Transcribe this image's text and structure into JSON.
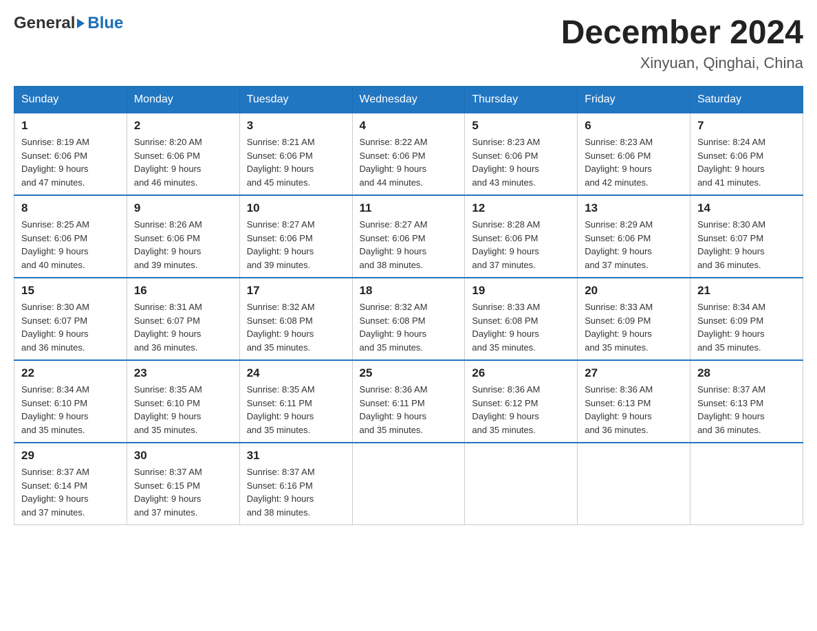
{
  "header": {
    "logo": {
      "general": "General",
      "blue": "Blue"
    },
    "title": "December 2024",
    "location": "Xinyuan, Qinghai, China"
  },
  "calendar": {
    "days_of_week": [
      "Sunday",
      "Monday",
      "Tuesday",
      "Wednesday",
      "Thursday",
      "Friday",
      "Saturday"
    ],
    "weeks": [
      [
        {
          "day": "1",
          "sunrise": "8:19 AM",
          "sunset": "6:06 PM",
          "daylight": "9 hours and 47 minutes."
        },
        {
          "day": "2",
          "sunrise": "8:20 AM",
          "sunset": "6:06 PM",
          "daylight": "9 hours and 46 minutes."
        },
        {
          "day": "3",
          "sunrise": "8:21 AM",
          "sunset": "6:06 PM",
          "daylight": "9 hours and 45 minutes."
        },
        {
          "day": "4",
          "sunrise": "8:22 AM",
          "sunset": "6:06 PM",
          "daylight": "9 hours and 44 minutes."
        },
        {
          "day": "5",
          "sunrise": "8:23 AM",
          "sunset": "6:06 PM",
          "daylight": "9 hours and 43 minutes."
        },
        {
          "day": "6",
          "sunrise": "8:23 AM",
          "sunset": "6:06 PM",
          "daylight": "9 hours and 42 minutes."
        },
        {
          "day": "7",
          "sunrise": "8:24 AM",
          "sunset": "6:06 PM",
          "daylight": "9 hours and 41 minutes."
        }
      ],
      [
        {
          "day": "8",
          "sunrise": "8:25 AM",
          "sunset": "6:06 PM",
          "daylight": "9 hours and 40 minutes."
        },
        {
          "day": "9",
          "sunrise": "8:26 AM",
          "sunset": "6:06 PM",
          "daylight": "9 hours and 39 minutes."
        },
        {
          "day": "10",
          "sunrise": "8:27 AM",
          "sunset": "6:06 PM",
          "daylight": "9 hours and 39 minutes."
        },
        {
          "day": "11",
          "sunrise": "8:27 AM",
          "sunset": "6:06 PM",
          "daylight": "9 hours and 38 minutes."
        },
        {
          "day": "12",
          "sunrise": "8:28 AM",
          "sunset": "6:06 PM",
          "daylight": "9 hours and 37 minutes."
        },
        {
          "day": "13",
          "sunrise": "8:29 AM",
          "sunset": "6:06 PM",
          "daylight": "9 hours and 37 minutes."
        },
        {
          "day": "14",
          "sunrise": "8:30 AM",
          "sunset": "6:07 PM",
          "daylight": "9 hours and 36 minutes."
        }
      ],
      [
        {
          "day": "15",
          "sunrise": "8:30 AM",
          "sunset": "6:07 PM",
          "daylight": "9 hours and 36 minutes."
        },
        {
          "day": "16",
          "sunrise": "8:31 AM",
          "sunset": "6:07 PM",
          "daylight": "9 hours and 36 minutes."
        },
        {
          "day": "17",
          "sunrise": "8:32 AM",
          "sunset": "6:08 PM",
          "daylight": "9 hours and 35 minutes."
        },
        {
          "day": "18",
          "sunrise": "8:32 AM",
          "sunset": "6:08 PM",
          "daylight": "9 hours and 35 minutes."
        },
        {
          "day": "19",
          "sunrise": "8:33 AM",
          "sunset": "6:08 PM",
          "daylight": "9 hours and 35 minutes."
        },
        {
          "day": "20",
          "sunrise": "8:33 AM",
          "sunset": "6:09 PM",
          "daylight": "9 hours and 35 minutes."
        },
        {
          "day": "21",
          "sunrise": "8:34 AM",
          "sunset": "6:09 PM",
          "daylight": "9 hours and 35 minutes."
        }
      ],
      [
        {
          "day": "22",
          "sunrise": "8:34 AM",
          "sunset": "6:10 PM",
          "daylight": "9 hours and 35 minutes."
        },
        {
          "day": "23",
          "sunrise": "8:35 AM",
          "sunset": "6:10 PM",
          "daylight": "9 hours and 35 minutes."
        },
        {
          "day": "24",
          "sunrise": "8:35 AM",
          "sunset": "6:11 PM",
          "daylight": "9 hours and 35 minutes."
        },
        {
          "day": "25",
          "sunrise": "8:36 AM",
          "sunset": "6:11 PM",
          "daylight": "9 hours and 35 minutes."
        },
        {
          "day": "26",
          "sunrise": "8:36 AM",
          "sunset": "6:12 PM",
          "daylight": "9 hours and 35 minutes."
        },
        {
          "day": "27",
          "sunrise": "8:36 AM",
          "sunset": "6:13 PM",
          "daylight": "9 hours and 36 minutes."
        },
        {
          "day": "28",
          "sunrise": "8:37 AM",
          "sunset": "6:13 PM",
          "daylight": "9 hours and 36 minutes."
        }
      ],
      [
        {
          "day": "29",
          "sunrise": "8:37 AM",
          "sunset": "6:14 PM",
          "daylight": "9 hours and 37 minutes."
        },
        {
          "day": "30",
          "sunrise": "8:37 AM",
          "sunset": "6:15 PM",
          "daylight": "9 hours and 37 minutes."
        },
        {
          "day": "31",
          "sunrise": "8:37 AM",
          "sunset": "6:16 PM",
          "daylight": "9 hours and 38 minutes."
        },
        null,
        null,
        null,
        null
      ]
    ],
    "labels": {
      "sunrise": "Sunrise:",
      "sunset": "Sunset:",
      "daylight": "Daylight:"
    }
  }
}
